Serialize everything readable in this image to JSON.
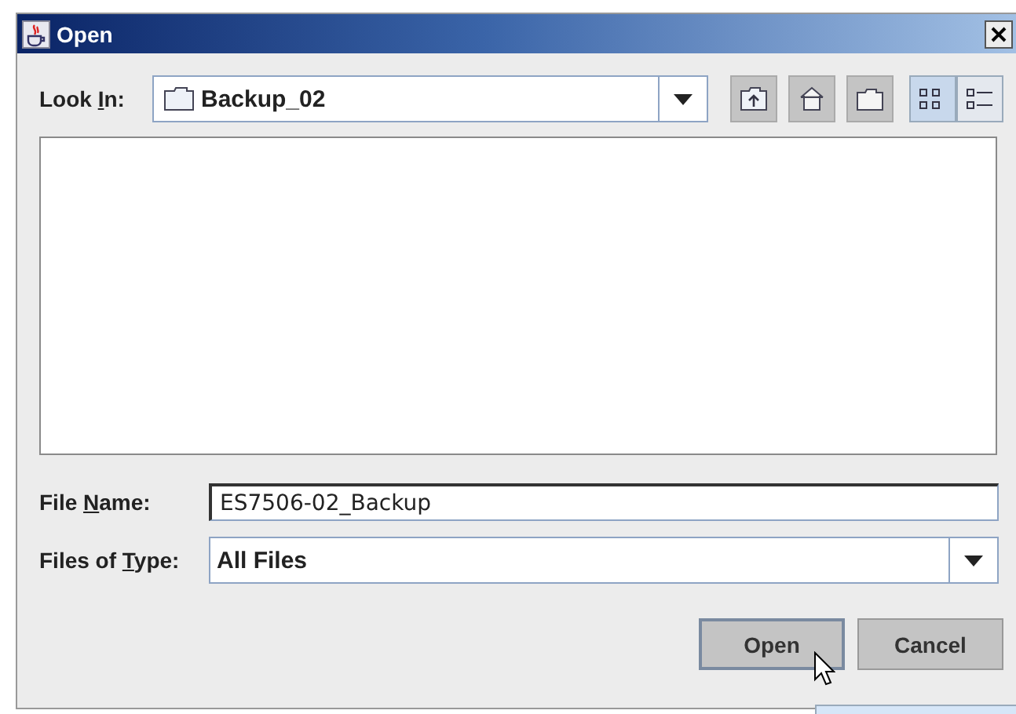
{
  "window": {
    "title": "Open"
  },
  "look_in": {
    "label": {
      "before": "Look ",
      "key": "I",
      "after": "n:"
    },
    "value": "Backup_02"
  },
  "toolbar": [
    {
      "kind": "up"
    },
    {
      "kind": "home"
    },
    {
      "kind": "new-folder"
    },
    {
      "kind": "list",
      "selected": true
    },
    {
      "kind": "details",
      "selected": false
    }
  ],
  "file_name": {
    "label": {
      "before": "File ",
      "key": "N",
      "after": "ame:"
    },
    "value": "ES7506-02_Backup"
  },
  "files_of_type": {
    "label": {
      "before": "Files of ",
      "key": "T",
      "after": "ype:"
    },
    "value": "All Files"
  },
  "buttons": [
    {
      "label": "Open",
      "focused": true
    },
    {
      "label": "Cancel",
      "focused": false
    }
  ]
}
